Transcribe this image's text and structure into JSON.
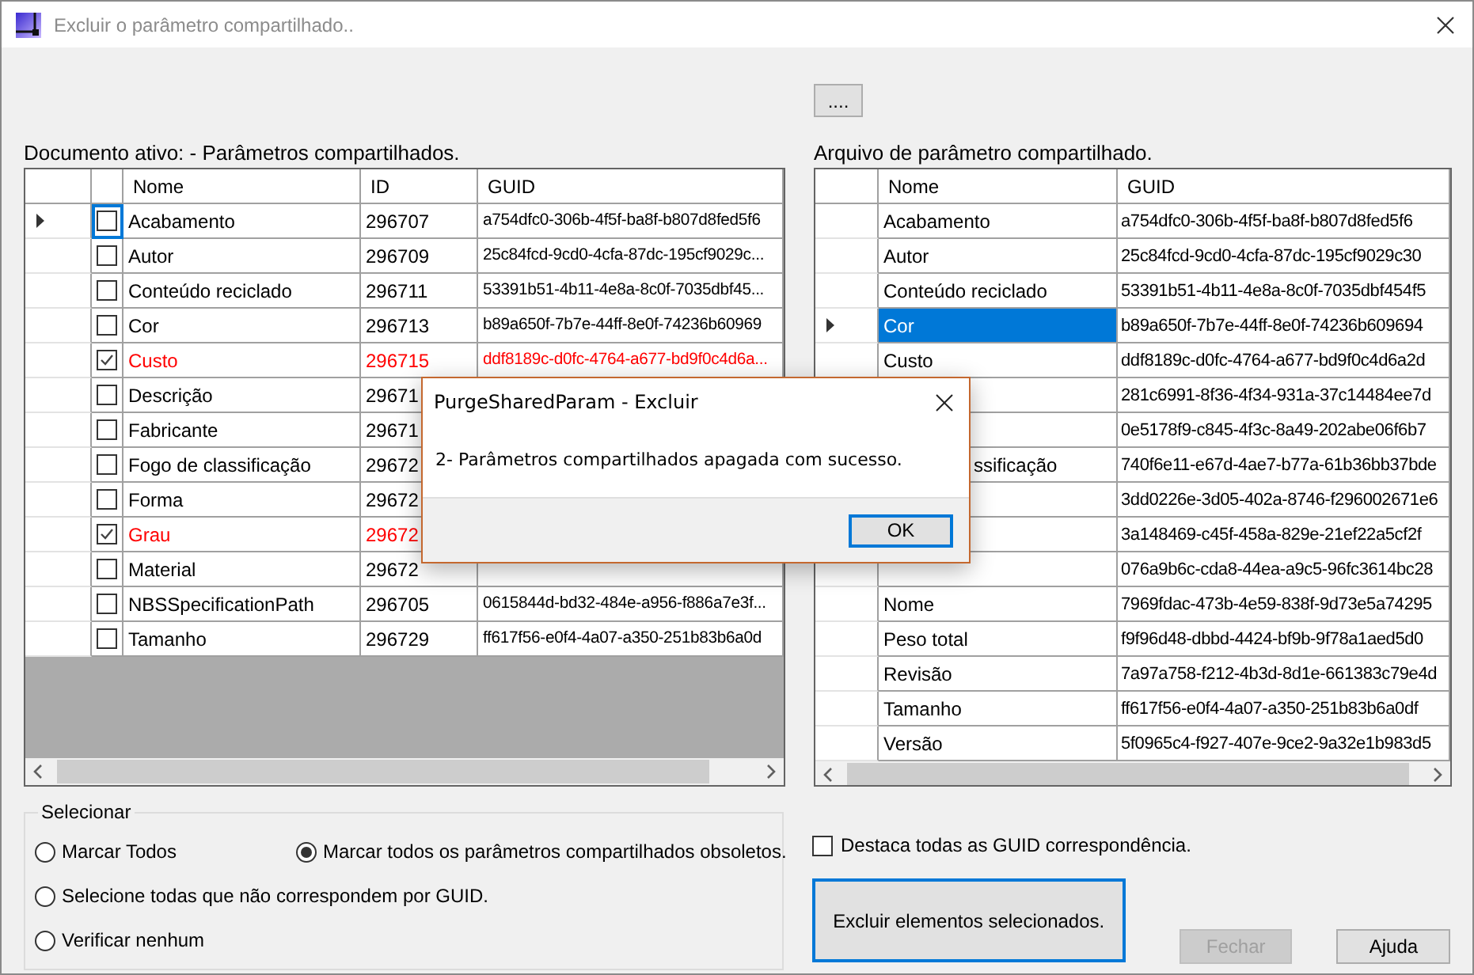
{
  "window": {
    "title": "Excluir o parâmetro compartilhado.."
  },
  "browse_button": "....",
  "document_panel": {
    "label": "Documento ativo: - Parâmetros compartilhados.",
    "columns": [
      "Nome",
      "ID",
      "GUID"
    ],
    "rows": [
      {
        "name": "Acabamento",
        "id": "296707",
        "guid": "a754dfc0-306b-4f5f-ba8f-b807d8fed5f6",
        "checked": false,
        "current": true
      },
      {
        "name": "Autor",
        "id": "296709",
        "guid": "25c84fcd-9cd0-4cfa-87dc-195cf9029c...",
        "checked": false,
        "current": false
      },
      {
        "name": "Conteúdo reciclado",
        "id": "296711",
        "guid": "53391b51-4b11-4e8a-8c0f-7035dbf45...",
        "checked": false,
        "current": false
      },
      {
        "name": "Cor",
        "id": "296713",
        "guid": "b89a650f-7b7e-44ff-8e0f-74236b60969",
        "checked": false,
        "current": false
      },
      {
        "name": "Custo",
        "id": "296715",
        "guid": "ddf8189c-d0fc-4764-a677-bd9f0c4d6a...",
        "checked": true,
        "current": false
      },
      {
        "name": "Descrição",
        "id": "29671",
        "checked": false,
        "current": false
      },
      {
        "name": "Fabricante",
        "id": "29671",
        "checked": false,
        "current": false
      },
      {
        "name": "Fogo de classificação",
        "id": "29672",
        "checked": false,
        "current": false
      },
      {
        "name": "Forma",
        "id": "29672",
        "checked": false,
        "current": false
      },
      {
        "name": "Grau",
        "id": "29672",
        "checked": true,
        "current": false
      },
      {
        "name": "Material",
        "id": "29672",
        "checked": false,
        "current": false
      },
      {
        "name": "NBSSpecificationPath",
        "id": "296705",
        "guid": "0615844d-bd32-484e-a956-f886a7e3f...",
        "checked": false,
        "current": false
      },
      {
        "name": "Tamanho",
        "id": "296729",
        "guid": "ff617f56-e0f4-4a07-a350-251b83b6a0d",
        "checked": false,
        "current": false
      }
    ]
  },
  "file_panel": {
    "label": "Arquivo de parâmetro compartilhado.",
    "columns": [
      "Nome",
      "GUID"
    ],
    "rows": [
      {
        "name": "Acabamento",
        "guid": "a754dfc0-306b-4f5f-ba8f-b807d8fed5f6",
        "current": false
      },
      {
        "name": "Autor",
        "guid": "25c84fcd-9cd0-4cfa-87dc-195cf9029c30",
        "current": false
      },
      {
        "name": "Conteúdo reciclado",
        "guid": "53391b51-4b11-4e8a-8c0f-7035dbf454f5",
        "current": false
      },
      {
        "name": "Cor",
        "guid": "b89a650f-7b7e-44ff-8e0f-74236b609694",
        "current": true
      },
      {
        "name": "Custo",
        "guid": "ddf8189c-d0fc-4764-a677-bd9f0c4d6a2d",
        "current": false
      },
      {
        "guid": "281c6991-8f36-4f34-931a-37c14484ee7d"
      },
      {
        "guid": "0e5178f9-c845-4f3c-8a49-202abe06f6b7"
      },
      {
        "name": "ssificação",
        "name_clipped": true,
        "guid": "740f6e11-e67d-4ae7-b77a-61b36bb37bde"
      },
      {
        "guid": "3dd0226e-3d05-402a-8746-f296002671e6"
      },
      {
        "guid": "3a148469-c45f-458a-829e-21ef22a5cf2f"
      },
      {
        "guid": "076a9b6c-cda8-44ea-a9c5-96fc3614bc28"
      },
      {
        "name": "Nome",
        "guid": "7969fdac-473b-4e59-838f-9d73e5a74295",
        "current": false
      },
      {
        "name": "Peso total",
        "guid": "f9f96d48-dbbd-4424-bf9b-9f78a1aed5d0",
        "current": false
      },
      {
        "name": "Revisão",
        "guid": "7a97a758-f212-4b3d-8d1e-661383c79e4d",
        "current": false
      },
      {
        "name": "Tamanho",
        "guid": "ff617f56-e0f4-4a07-a350-251b83b6a0df",
        "current": false
      },
      {
        "name": "Versão",
        "guid": "5f0965c4-f927-407e-9ce2-9a32e1b983d5",
        "current": false
      }
    ]
  },
  "select_group": {
    "title": "Selecionar",
    "options": [
      {
        "label": "Marcar Todos",
        "selected": false
      },
      {
        "label": "Marcar todos os parâmetros compartilhados obsoletos.",
        "selected": true
      },
      {
        "label": "Selecione todas que não correspondem por GUID.",
        "selected": false
      },
      {
        "label": "Verificar nenhum",
        "selected": false
      }
    ]
  },
  "highlight_checkbox": {
    "label": "Destaca todas as GUID correspondência.",
    "checked": false
  },
  "delete_button": "Excluir elementos selecionados.",
  "buttons": [
    {
      "label": "Fechar",
      "disabled": true
    },
    {
      "label": "Ajuda",
      "disabled": false
    }
  ],
  "dialog": {
    "title": "PurgeSharedParam - Excluir",
    "message": "2- Parâmetros compartilhados apagada com sucesso.",
    "button": "OK"
  }
}
